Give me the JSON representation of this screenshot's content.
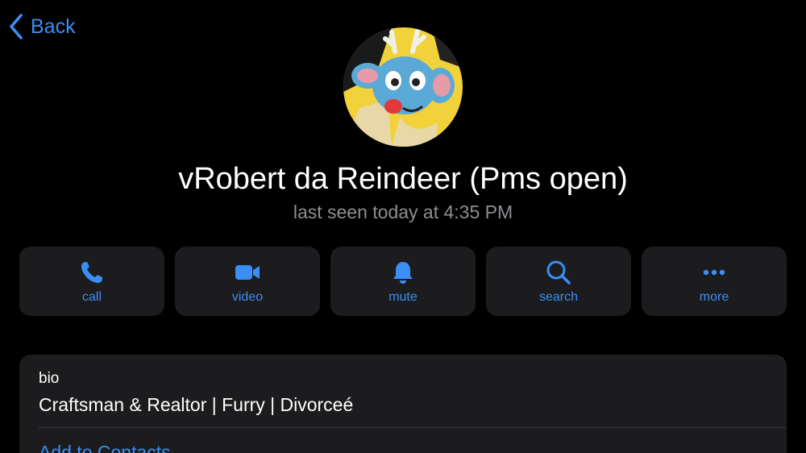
{
  "nav": {
    "back_label": "Back",
    "back_icon": "chevron-left-icon"
  },
  "profile": {
    "name": "vRobert da Reindeer (Pms open)",
    "last_seen": "last seen today at 4:35 PM",
    "avatar": "reindeer-character-avatar"
  },
  "actions": [
    {
      "label": "call",
      "icon": "phone-icon"
    },
    {
      "label": "video",
      "icon": "video-camera-icon"
    },
    {
      "label": "mute",
      "icon": "bell-icon"
    },
    {
      "label": "search",
      "icon": "magnifier-icon"
    },
    {
      "label": "more",
      "icon": "ellipsis-icon"
    }
  ],
  "info": {
    "bio_label": "bio",
    "bio_text": "Craftsman & Realtor | Furry | Divorceé",
    "add_contact_label": "Add to Contacts"
  },
  "colors": {
    "background": "#000000",
    "card": "#1c1c1e",
    "accent": "#3a8ef6",
    "secondary_text": "#8e8e93",
    "divider": "#38383a"
  }
}
